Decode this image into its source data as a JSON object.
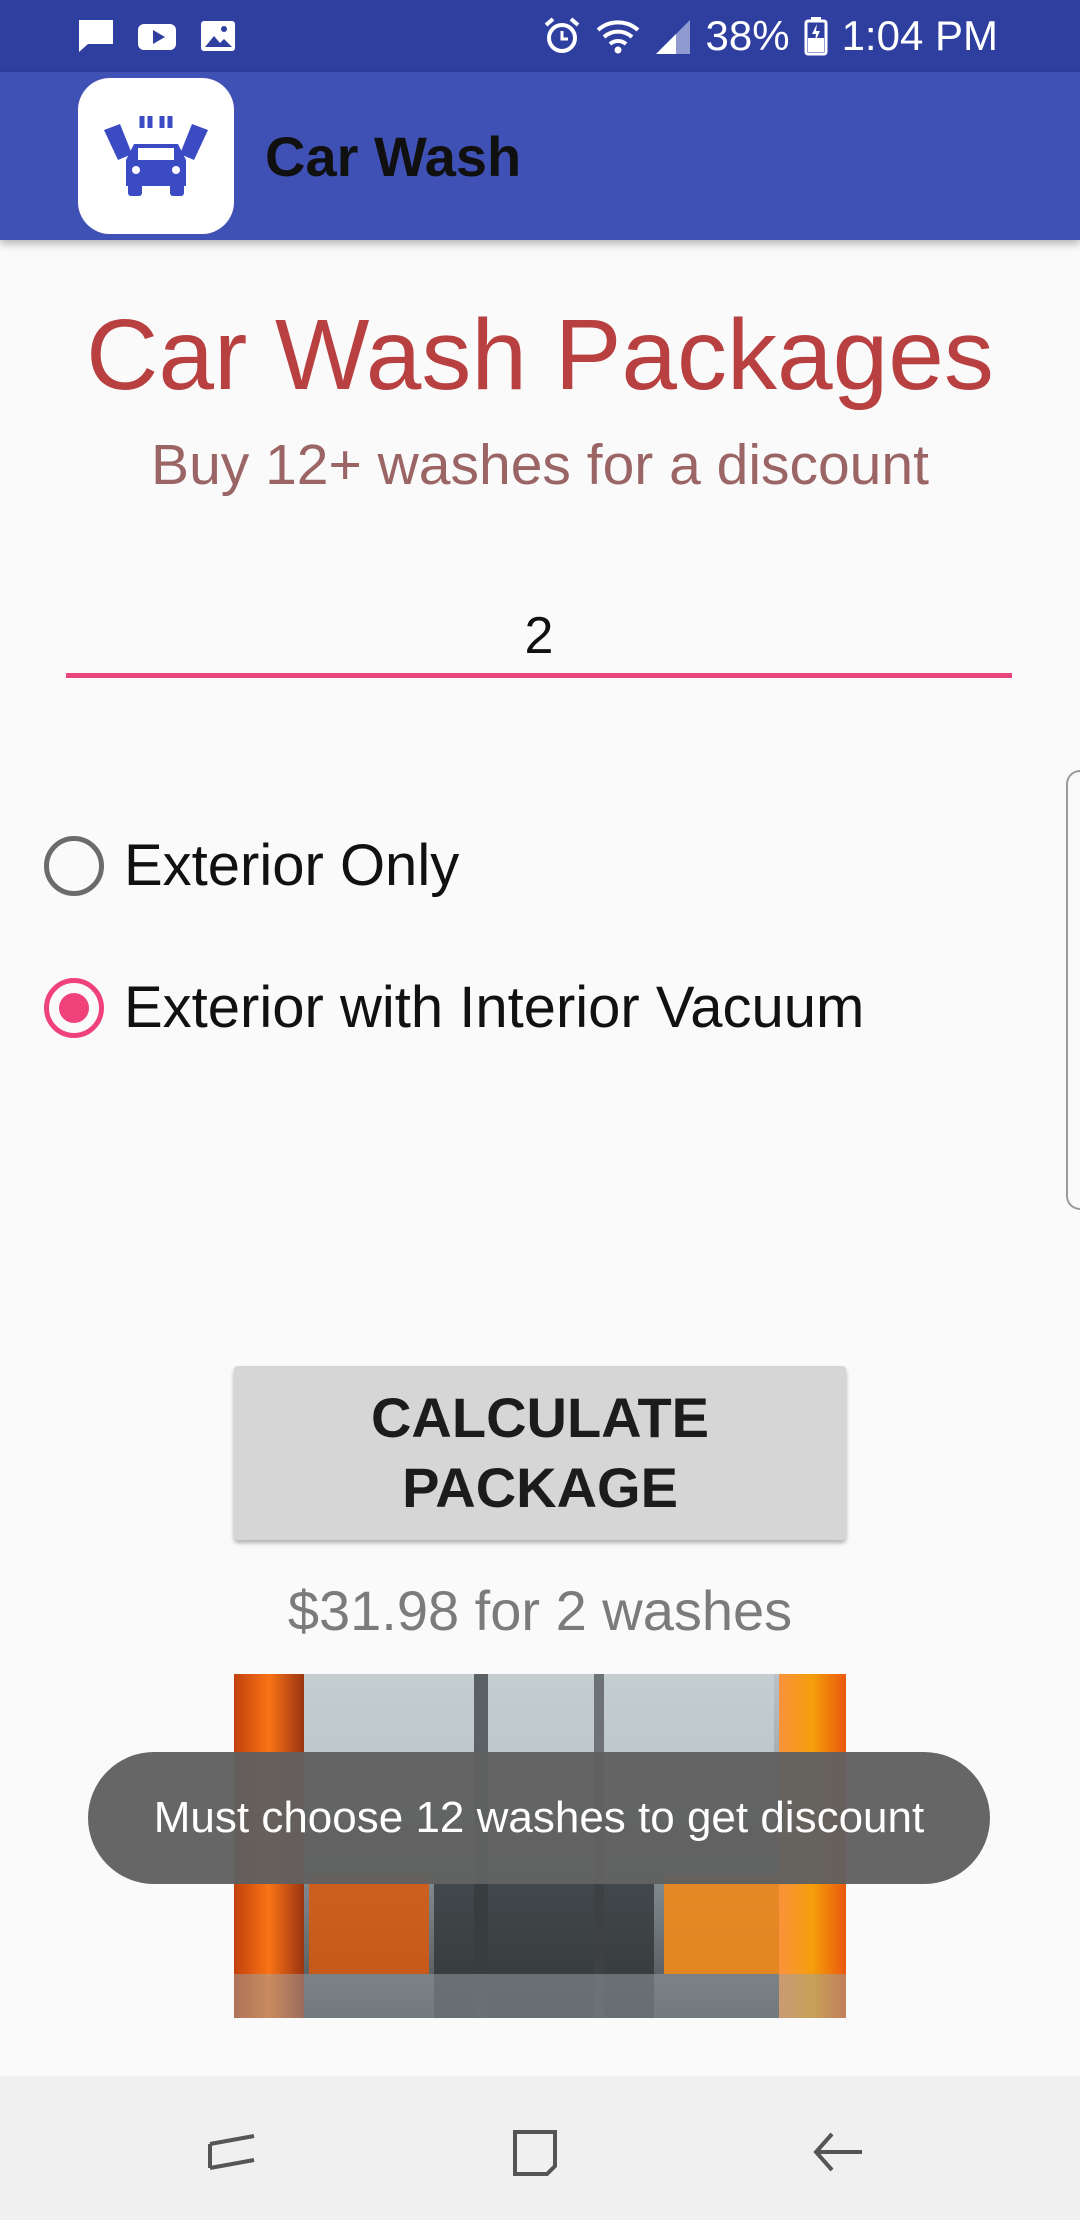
{
  "status_bar": {
    "battery": "38%",
    "time": "1:04 PM",
    "left_icons": [
      "chat-icon",
      "youtube-icon",
      "gallery-icon"
    ],
    "right_icons": [
      "alarm-icon",
      "wifi-icon",
      "signal-icon",
      "battery-icon"
    ]
  },
  "app_bar": {
    "title": "Car Wash",
    "color": "#3f51b5"
  },
  "content": {
    "title": "Car Wash Packages",
    "subtitle": "Buy 12+ washes for a discount",
    "quantity_value": "2",
    "options": [
      {
        "label": "Exterior Only",
        "checked": false
      },
      {
        "label": "Exterior with Interior Vacuum",
        "checked": true
      }
    ],
    "calculate_label_line1": "CALCULATE",
    "calculate_label_line2": "PACKAGE",
    "result": "$31.98 for 2 washes",
    "accent_color": "#f0427a"
  },
  "toast": {
    "message": "Must choose 12 washes to get discount"
  },
  "nav_bar": {
    "icons": [
      "recents-icon",
      "home-icon",
      "back-icon"
    ]
  }
}
